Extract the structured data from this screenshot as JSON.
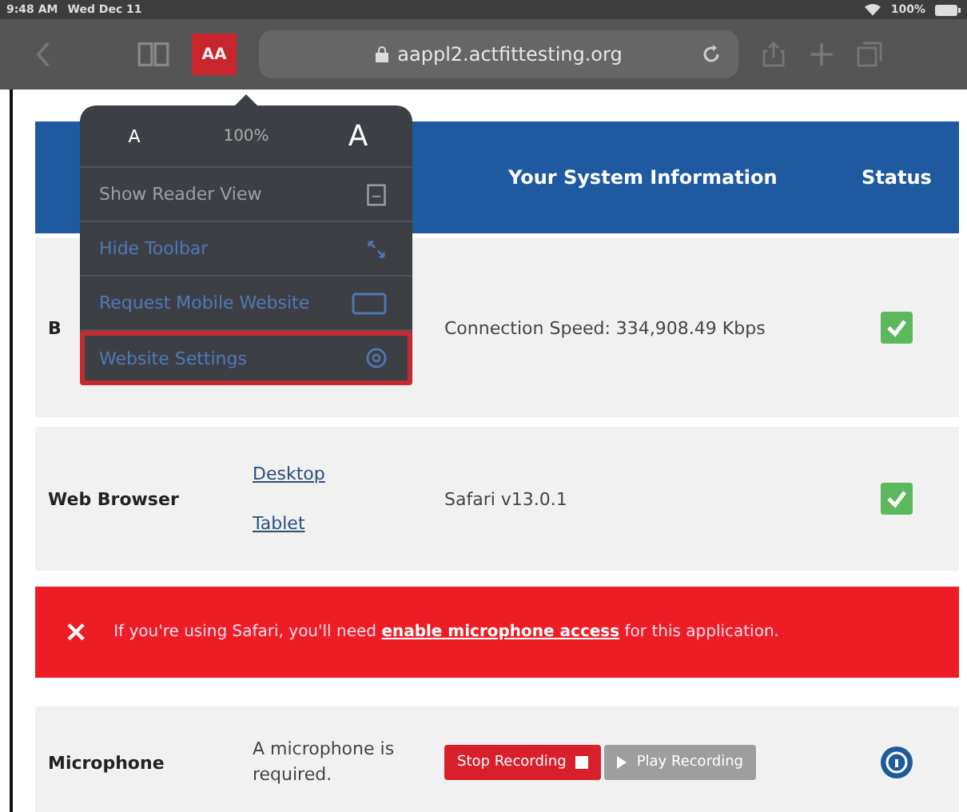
{
  "status_bar": {
    "time": "9:48 AM",
    "date": "Wed Dec 11",
    "battery": "100%"
  },
  "toolbar": {
    "reader_button": {
      "label": "AA",
      "highlighted": true
    },
    "url": "aappl2.actfittesting.org"
  },
  "popover": {
    "font_small": "A",
    "zoom": "100%",
    "font_large": "A",
    "items": [
      {
        "label": "Show Reader View",
        "kind": "reader",
        "disabled": true,
        "selected": false
      },
      {
        "label": "Hide Toolbar",
        "kind": "arrows",
        "disabled": false,
        "selected": false
      },
      {
        "label": "Request Mobile Website",
        "kind": "tablet",
        "disabled": false,
        "selected": false
      },
      {
        "label": "Website Settings",
        "kind": "gear",
        "disabled": false,
        "selected": true
      }
    ]
  },
  "table": {
    "columns": [
      "Your System Information",
      "Status"
    ],
    "rows": [
      {
        "label": "B",
        "info": "Connection Speed: 334,908.49 Kbps",
        "status": {
          "kind": "check"
        }
      },
      {
        "label": "Web Browser",
        "links": [
          "Desktop",
          "Tablet"
        ],
        "info": "Safari v13.0.1",
        "status": {
          "kind": "check"
        }
      },
      {
        "label": "Microphone",
        "note": "A microphone is required.",
        "buttons": [
          {
            "label": "Stop Recording",
            "disabled": false
          },
          {
            "label": "Play Recording",
            "disabled": true
          }
        ],
        "status": {
          "kind": "info"
        }
      }
    ]
  },
  "alert": {
    "close": "×",
    "text_before": "If you're using Safari, you'll need ",
    "link": "enable microphone access",
    "text_after": " for this application."
  }
}
